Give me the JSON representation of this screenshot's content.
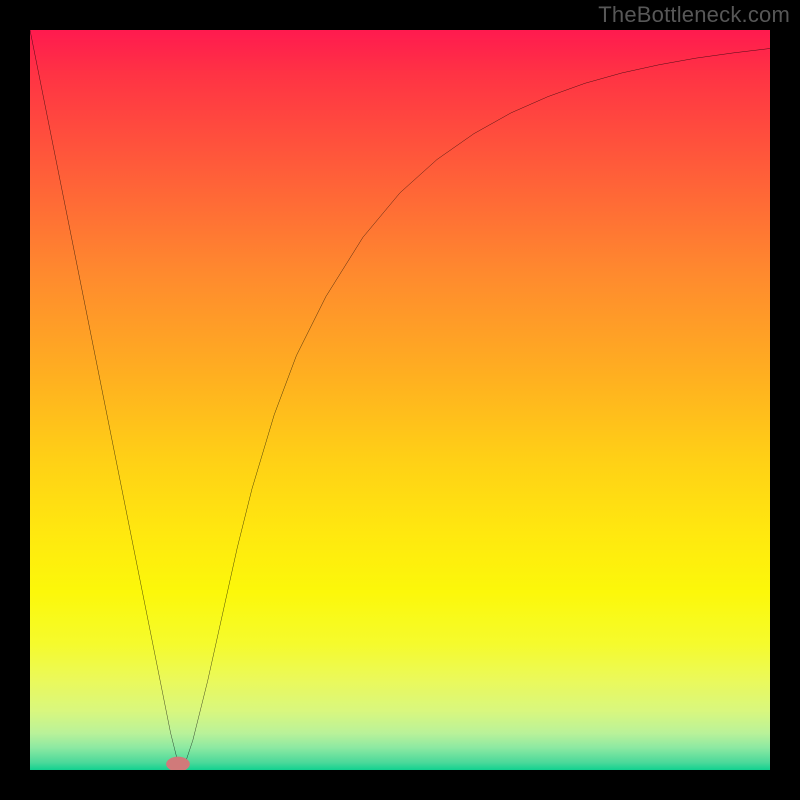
{
  "watermark": "TheBottleneck.com",
  "chart_data": {
    "type": "line",
    "title": "",
    "xlabel": "",
    "ylabel": "",
    "xlim": [
      0,
      100
    ],
    "ylim": [
      0,
      100
    ],
    "grid": false,
    "series": [
      {
        "name": "bottleneck-curve",
        "color": "#000000",
        "x": [
          0,
          2,
          4,
          6,
          8,
          10,
          12,
          14,
          16,
          18,
          19,
          20,
          21,
          22,
          24,
          26,
          28,
          30,
          33,
          36,
          40,
          45,
          50,
          55,
          60,
          65,
          70,
          75,
          80,
          85,
          90,
          95,
          100
        ],
        "y": [
          100,
          90,
          80,
          70,
          60,
          50,
          40,
          30,
          20,
          10,
          5,
          1,
          1,
          4,
          12,
          21,
          30,
          38,
          48,
          56,
          64,
          72,
          78,
          82.5,
          86,
          88.8,
          91,
          92.8,
          94.2,
          95.3,
          96.2,
          96.9,
          97.5
        ]
      }
    ],
    "marker": {
      "name": "bottleneck-marker",
      "x": 20,
      "y": 0.8,
      "color": "#d07a7a",
      "rx": 1.6,
      "ry": 1.0
    },
    "background_gradient": [
      {
        "offset": 0,
        "color": "#ff1a4f"
      },
      {
        "offset": 50,
        "color": "#ffc81a"
      },
      {
        "offset": 80,
        "color": "#faf610"
      },
      {
        "offset": 100,
        "color": "#11d190"
      }
    ]
  }
}
